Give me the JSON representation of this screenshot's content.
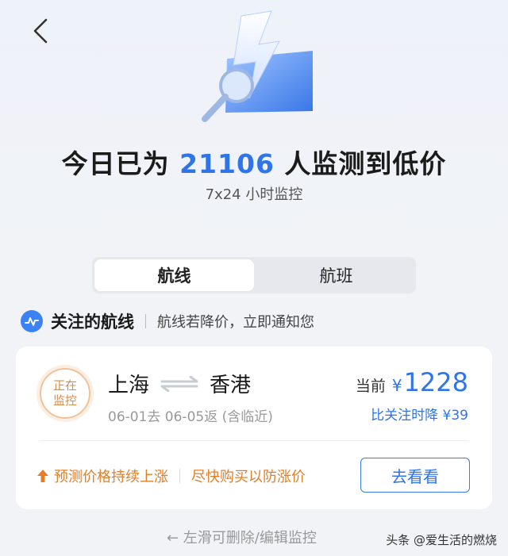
{
  "nav": {
    "back_icon": "chevron-left-icon"
  },
  "hero": {
    "icon": "lightning-magnifier-icon"
  },
  "headline": {
    "prefix": "今日已为 ",
    "count": "21106",
    "suffix": " 人监测到低价"
  },
  "subline": "7x24 小时监控",
  "tabs": [
    {
      "label": "航线",
      "active": true
    },
    {
      "label": "航班",
      "active": false
    }
  ],
  "section": {
    "title": "关注的航线",
    "description": "航线若降价，立即通知您",
    "icon": "pulse-icon"
  },
  "card": {
    "badge": {
      "line1": "正在",
      "line2": "监控"
    },
    "origin": "上海",
    "destination": "香港",
    "dates": "06-01去 06-05返 (含临近)",
    "price_label": "当前",
    "price_currency": "¥",
    "price_value": "1228",
    "drop_note": "比关注时降 ¥39",
    "trend_text": "预测价格持续上涨",
    "advice_text": "尽快购买以防涨价",
    "view_button": "去看看"
  },
  "hint": "← 左滑可删除/编辑监控",
  "watermark": "头条 @爱生活的燃烧",
  "colors": {
    "accent": "#2f74e8",
    "warning": "#e07f2a",
    "badge": "#d98b4a"
  }
}
